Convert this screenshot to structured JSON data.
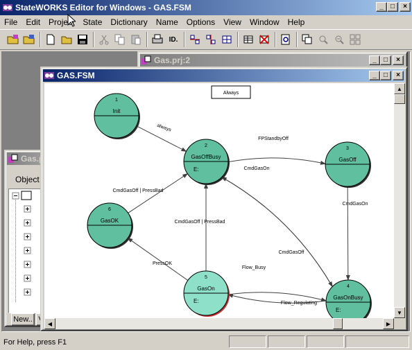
{
  "app": {
    "title": "StateWORKS Editor for Windows - GAS.FSM",
    "window_buttons": {
      "minimize": "_",
      "maximize": "□",
      "close": "×"
    }
  },
  "menu": [
    "File",
    "Edit",
    "Project",
    "State",
    "Dictionary",
    "Name",
    "Options",
    "View",
    "Window",
    "Help"
  ],
  "toolbar": {
    "buttons": [
      {
        "name": "open-project-icon"
      },
      {
        "name": "save-project-icon"
      },
      {
        "name": "new-file-icon"
      },
      {
        "name": "open-file-icon"
      },
      {
        "name": "save-file-icon"
      },
      {
        "name": "cut-icon"
      },
      {
        "name": "copy-icon"
      },
      {
        "name": "paste-icon"
      },
      {
        "name": "print-icon"
      },
      {
        "name": "id-icon",
        "label": "ID."
      },
      {
        "name": "align-icon"
      },
      {
        "name": "align-2-icon"
      },
      {
        "name": "grid-icon"
      },
      {
        "name": "table-icon"
      },
      {
        "name": "delete-table-icon"
      },
      {
        "name": "preview-icon"
      },
      {
        "name": "cascade-icon"
      },
      {
        "name": "zoom-in-icon"
      },
      {
        "name": "zoom-out-icon"
      },
      {
        "name": "tile-icon"
      }
    ]
  },
  "windows": {
    "project": {
      "title": "Gas.prj:2"
    },
    "objects": {
      "title": "Gas.p",
      "tab_label": "Object",
      "buttons": [
        "New..",
        "V"
      ]
    },
    "fsm": {
      "title": "GAS.FSM"
    }
  },
  "diagram": {
    "always_box": "Always",
    "states": [
      {
        "id": "1",
        "name": "Init",
        "entry": "",
        "highlight": false
      },
      {
        "id": "2",
        "name": "GasOffBusy",
        "entry": "E:",
        "highlight": false
      },
      {
        "id": "3",
        "name": "GasOff",
        "entry": "",
        "highlight": false
      },
      {
        "id": "4",
        "name": "GasOnBusy",
        "entry": "E:",
        "highlight": false
      },
      {
        "id": "5",
        "name": "GasOn",
        "entry": "E:",
        "highlight": true
      },
      {
        "id": "6",
        "name": "GasOK",
        "entry": "",
        "highlight": false
      }
    ],
    "transitions": [
      {
        "from": "1",
        "to": "2",
        "label": "always"
      },
      {
        "from": "2",
        "to": "3",
        "label": "FPStandbyOff"
      },
      {
        "from": "2",
        "to": "4",
        "label": "CmdGasOn"
      },
      {
        "from": "3",
        "to": "4",
        "label": "CmdGasOn"
      },
      {
        "from": "4",
        "to": "2",
        "label": "CmdGasOff"
      },
      {
        "from": "5",
        "to": "2",
        "label": "CmdGasOff | PressBad"
      },
      {
        "from": "6",
        "to": "2",
        "label": "CmdGasOff | PressBad"
      },
      {
        "from": "5",
        "to": "6",
        "label": "PressOK"
      },
      {
        "from": "5",
        "to": "4",
        "label": "Flow_Busy"
      },
      {
        "from": "4",
        "to": "5",
        "label": "Flow_Regulating"
      }
    ],
    "colors": {
      "state_fill": "#5fbf9f",
      "highlight_fill": "#8fe0c8",
      "highlight_border": "#c03030"
    }
  },
  "status": {
    "text": "For Help, press F1"
  }
}
